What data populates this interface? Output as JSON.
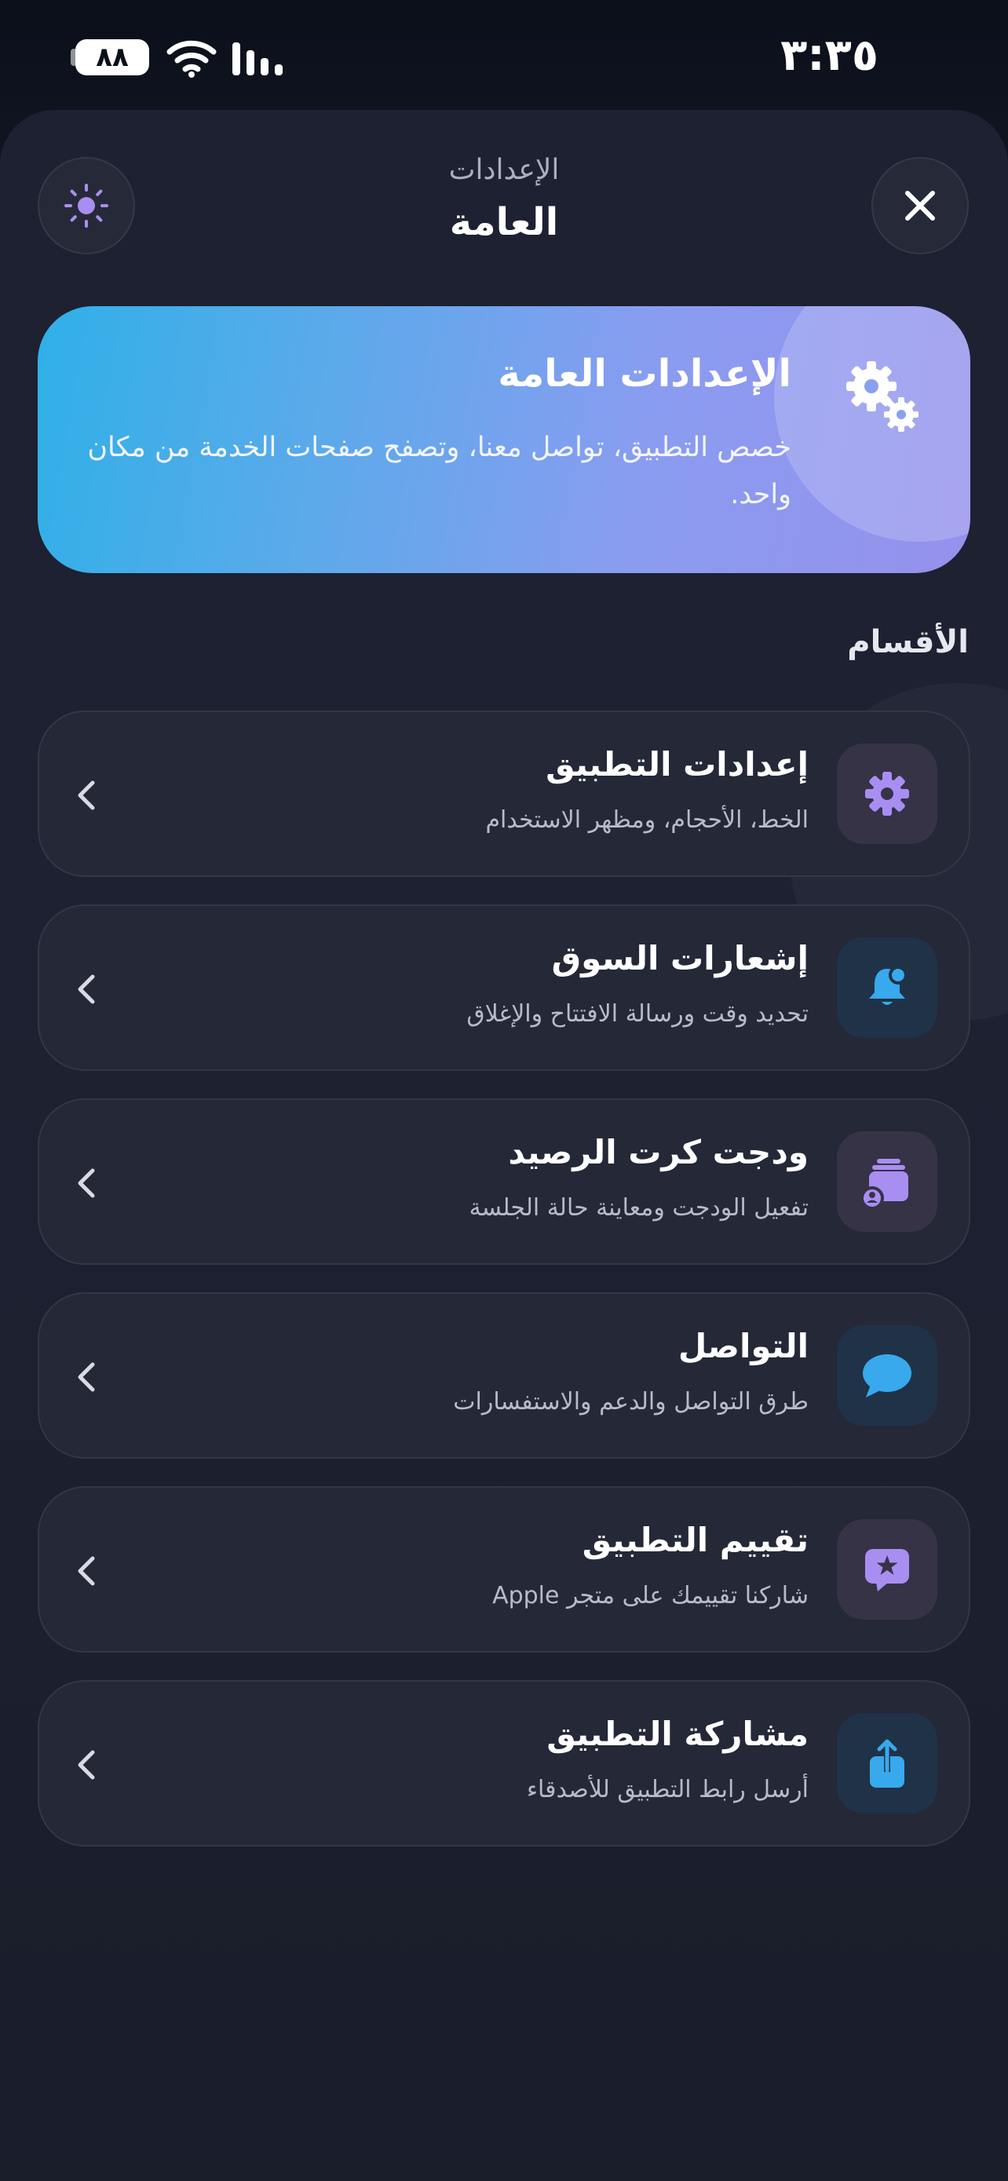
{
  "status_bar": {
    "time": "٣:٣٥",
    "battery": "٨٨"
  },
  "header": {
    "subtitle": "الإعدادات",
    "title": "العامة"
  },
  "hero": {
    "title": "الإعدادات العامة",
    "description": "خصص التطبيق، تواصل معنا، وتصفح صفحات الخدمة من مكان واحد."
  },
  "sections": {
    "label": "الأقسام",
    "items": [
      {
        "title": "إعدادات التطبيق",
        "subtitle": "الخط، الأحجام، ومظهر الاستخدام",
        "icon": "gear-icon"
      },
      {
        "title": "إشعارات السوق",
        "subtitle": "تحديد وقت ورسالة الافتتاح والإغلاق",
        "icon": "bell-icon"
      },
      {
        "title": "ودجت كرت الرصيد",
        "subtitle": "تفعيل الودجت ومعاينة حالة الجلسة",
        "icon": "card-stack-icon"
      },
      {
        "title": "التواصل",
        "subtitle": "طرق التواصل والدعم والاستفسارات",
        "icon": "chat-bubble-icon"
      },
      {
        "title": "تقييم التطبيق",
        "subtitle": "شاركنا تقييمك على متجر Apple",
        "icon": "star-bubble-icon"
      },
      {
        "title": "مشاركة التطبيق",
        "subtitle": "أرسل رابط التطبيق للأصدقاء",
        "icon": "share-icon"
      }
    ]
  },
  "colors": {
    "background": "#1d2131",
    "row_background": "#242837",
    "accent_purple": "#a98ef2",
    "accent_blue": "#38a9ec",
    "hero_gradient_start": "#2fb0e8",
    "hero_gradient_end": "#9591ec"
  }
}
